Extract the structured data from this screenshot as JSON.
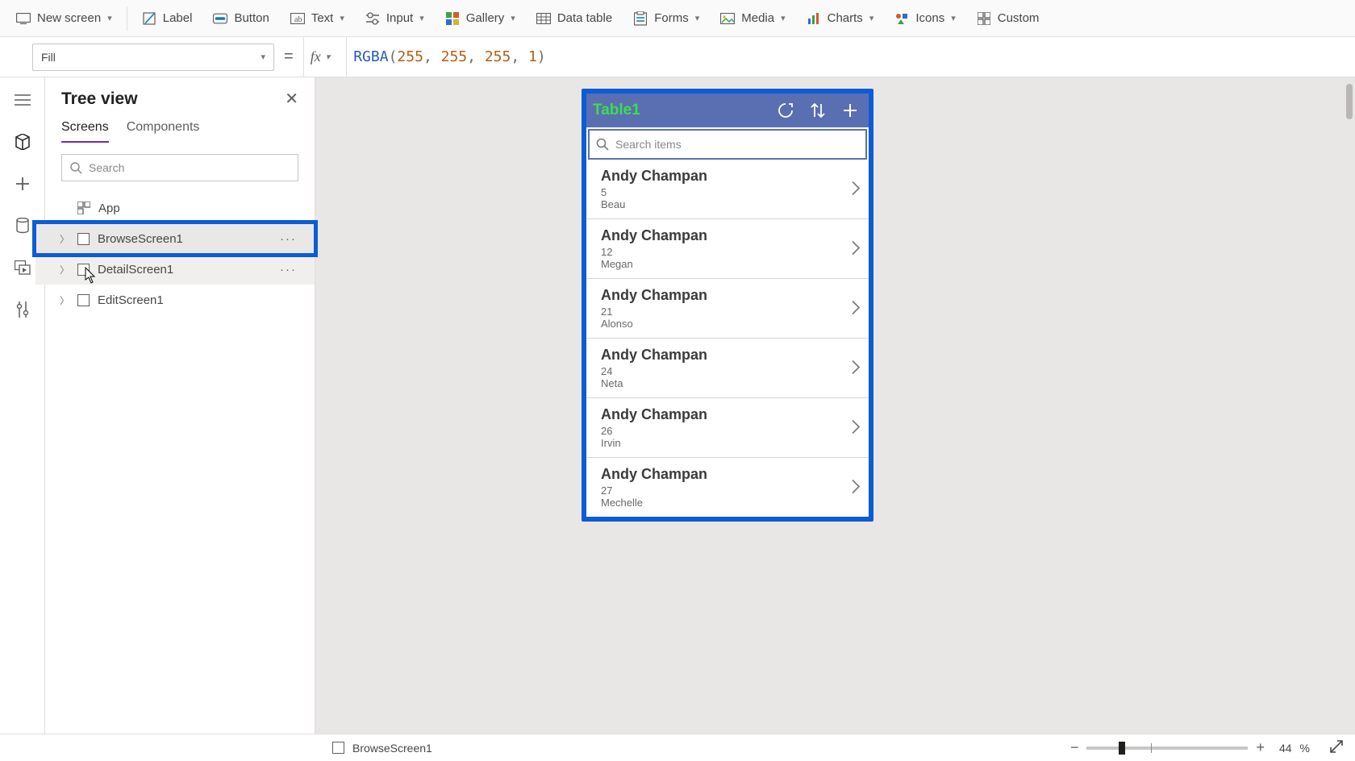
{
  "ribbon": {
    "new_screen": "New screen",
    "label": "Label",
    "button": "Button",
    "text": "Text",
    "input": "Input",
    "gallery": "Gallery",
    "data_table": "Data table",
    "forms": "Forms",
    "media": "Media",
    "charts": "Charts",
    "icons": "Icons",
    "custom": "Custom"
  },
  "formula": {
    "property": "Fill",
    "func": "RGBA",
    "args": [
      "255",
      "255",
      "255",
      "1"
    ]
  },
  "tree": {
    "title": "Tree view",
    "tabs": {
      "screens": "Screens",
      "components": "Components"
    },
    "search_placeholder": "Search",
    "app_label": "App",
    "items": [
      {
        "label": "BrowseScreen1"
      },
      {
        "label": "DetailScreen1"
      },
      {
        "label": "EditScreen1"
      }
    ]
  },
  "phone": {
    "title": "Table1",
    "search_placeholder": "Search items",
    "items": [
      {
        "title": "Andy Champan",
        "sub1": "5",
        "sub2": "Beau"
      },
      {
        "title": "Andy Champan",
        "sub1": "12",
        "sub2": "Megan"
      },
      {
        "title": "Andy Champan",
        "sub1": "21",
        "sub2": "Alonso"
      },
      {
        "title": "Andy Champan",
        "sub1": "24",
        "sub2": "Neta"
      },
      {
        "title": "Andy Champan",
        "sub1": "26",
        "sub2": "Irvin"
      },
      {
        "title": "Andy Champan",
        "sub1": "27",
        "sub2": "Mechelle"
      }
    ]
  },
  "status": {
    "selected": "BrowseScreen1",
    "zoom": "44",
    "percent": "%"
  }
}
